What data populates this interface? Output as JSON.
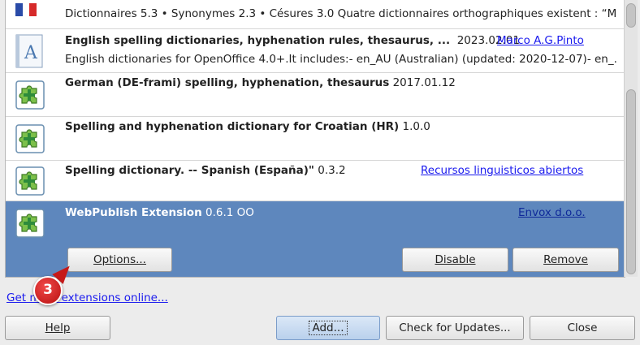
{
  "extensions": [
    {
      "title": "",
      "version": "",
      "desc": "Dictionnaires 5.3 • Synonymes 2.3 • Césures 3.0  Quatre dictionnaires orthographiques existent : “M...",
      "publisher": "",
      "icon": "french-flag-icon"
    },
    {
      "title": "English spelling dictionaries, hyphenation rules, thesaurus, ...",
      "version": "2023.02.01",
      "desc": "English dictionaries for OpenOffice 4.0+.It includes:- en_AU (Australian) (updated: 2020-12-07)- en_...",
      "publisher": "Marco A.G.Pinto",
      "icon": "document-a-icon"
    },
    {
      "title": "German (DE-frami) spelling, hyphenation, thesaurus",
      "version": "2017.01.12",
      "desc": "",
      "publisher": "",
      "icon": "puzzle-icon"
    },
    {
      "title": "Spelling and hyphenation dictionary for Croatian (HR)",
      "version": "1.0.0",
      "desc": "",
      "publisher": "",
      "icon": "puzzle-icon"
    },
    {
      "title": "Spelling dictionary. -- Spanish (España)\"",
      "version": "0.3.2",
      "desc": "",
      "publisher": "Recursos linguisticos abiertos",
      "icon": "puzzle-icon"
    },
    {
      "title": "WebPublish Extension",
      "version": "0.6.1 OO",
      "desc": "",
      "publisher": "Envox d.o.o.",
      "icon": "puzzle-icon"
    }
  ],
  "selected_actions": {
    "options": "Options...",
    "disable": "Disable",
    "remove": "Remove"
  },
  "get_more_link": "Get more extensions online...",
  "callout_number": "3",
  "bottom_buttons": {
    "help": "Help",
    "add": "Add...",
    "check_updates": "Check for Updates...",
    "close": "Close"
  },
  "colors": {
    "selection": "#5e87bd",
    "link": "#1a1aee",
    "callout": "#c61a1a"
  }
}
